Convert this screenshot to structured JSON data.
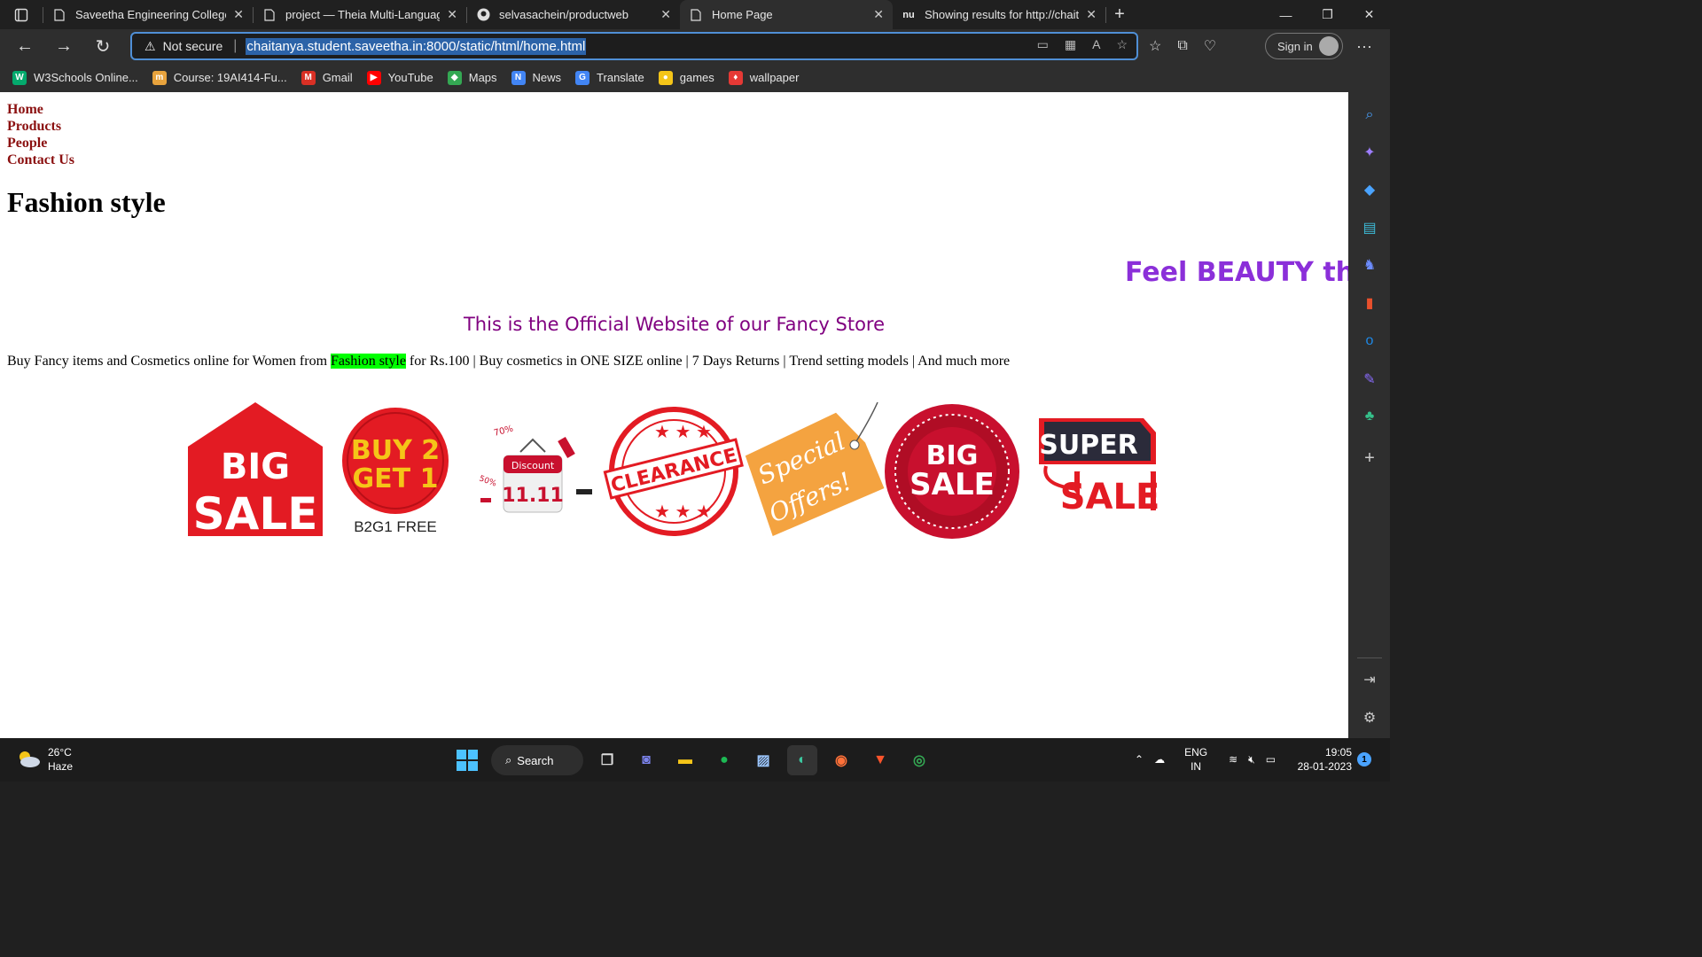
{
  "browser": {
    "tabs": [
      {
        "label": "Saveetha Engineering College",
        "icon": "page-icon",
        "active": false
      },
      {
        "label": "project — Theia Multi-Language",
        "icon": "page-icon",
        "active": false
      },
      {
        "label": "selvasachein/productweb",
        "icon": "github-icon",
        "active": false
      },
      {
        "label": "Home Page",
        "icon": "page-icon",
        "active": true
      },
      {
        "label": "Showing results for http://chaitar",
        "icon": "nu-icon",
        "active": false
      }
    ],
    "not_secure": "Not secure",
    "url": "chaitanya.student.saveetha.in:8000/static/html/home.html",
    "sign_in": "Sign in"
  },
  "favorites": [
    {
      "label": "W3Schools Online...",
      "color": "#04aa6d",
      "glyph": "W"
    },
    {
      "label": "Course: 19AI414-Fu...",
      "color": "#e8a33d",
      "glyph": "m"
    },
    {
      "label": "Gmail",
      "color": "#d93025",
      "glyph": "M"
    },
    {
      "label": "YouTube",
      "color": "#ff0000",
      "glyph": "▶"
    },
    {
      "label": "Maps",
      "color": "#34a853",
      "glyph": "◆"
    },
    {
      "label": "News",
      "color": "#4285f4",
      "glyph": "N"
    },
    {
      "label": "Translate",
      "color": "#4285f4",
      "glyph": "G"
    },
    {
      "label": "games",
      "color": "#f5c518",
      "glyph": "●"
    },
    {
      "label": "wallpaper",
      "color": "#e53935",
      "glyph": "♦"
    }
  ],
  "page": {
    "nav": [
      "Home",
      "Products",
      "People",
      "Contact Us"
    ],
    "title": "Fashion style",
    "marquee": "Feel BEAUTY th",
    "official": "This is the Official Website of our Fancy Store",
    "desc_before": "Buy Fancy items and Cosmetics online for Women from ",
    "desc_highlight": "Fashion style",
    "desc_after": " for Rs.100 | Buy cosmetics in ONE SIZE online | 7 Days Returns | Trend setting models | And much more",
    "stickers": {
      "big_sale_1": [
        "BIG",
        "SALE"
      ],
      "buy2get1": [
        "BUY 2",
        "GET 1",
        "B2G1 FREE"
      ],
      "discount": [
        "Discount",
        "11.11",
        "70%",
        "50%"
      ],
      "clearance": "CLEARANCE",
      "special": [
        "Special",
        "Offers!"
      ],
      "big_sale_2": [
        "BIG",
        "SALE"
      ],
      "super_sale": [
        "SUPER",
        "SALE"
      ]
    }
  },
  "taskbar": {
    "temp": "26°C",
    "weather": "Haze",
    "search": "Search",
    "lang1": "ENG",
    "lang2": "IN",
    "time": "19:05",
    "date": "28-01-2023",
    "notifications": "1"
  }
}
